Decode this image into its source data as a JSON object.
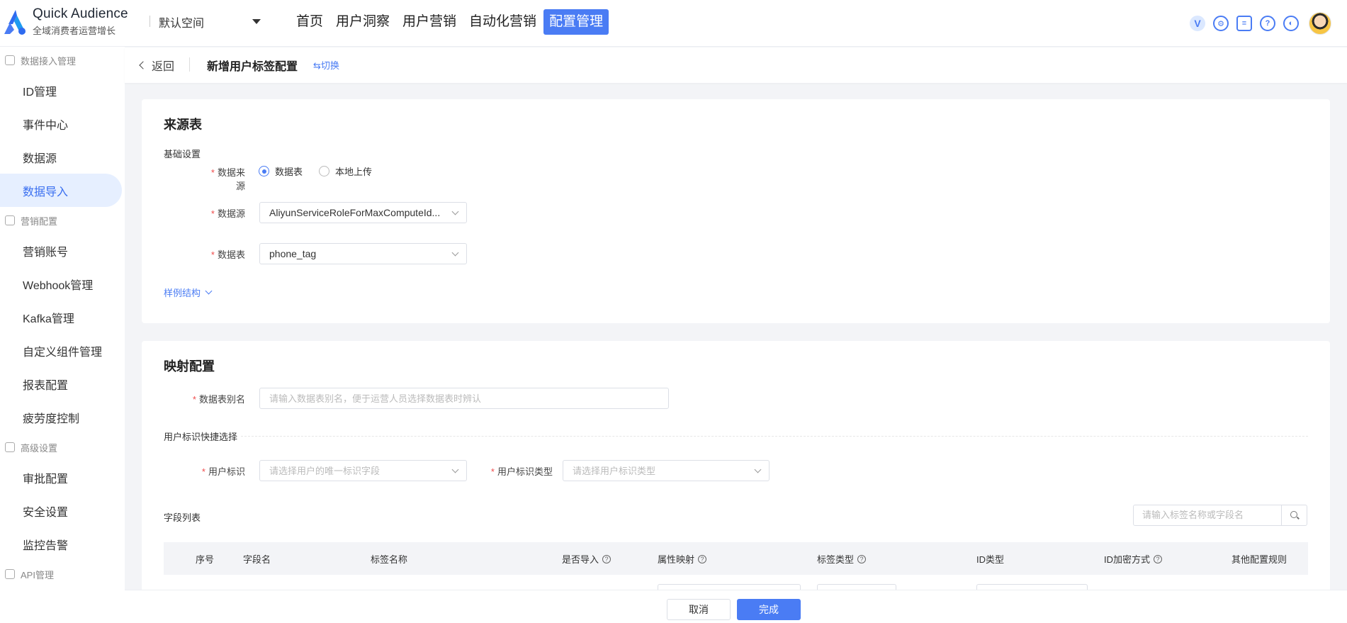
{
  "app": {
    "title": "Quick Audience",
    "subtitle": "全域消费者运营增长"
  },
  "workspace": {
    "current": "默认空间"
  },
  "nav": [
    {
      "label": "首页",
      "active": false
    },
    {
      "label": "用户洞察",
      "active": false
    },
    {
      "label": "用户营销",
      "active": false
    },
    {
      "label": "自动化营销",
      "active": false
    },
    {
      "label": "配置管理",
      "active": true
    }
  ],
  "top_icons": [
    "vip-icon",
    "settings-bug-icon",
    "message-icon",
    "help-icon",
    "globe-icon"
  ],
  "sidebar": {
    "groups": [
      {
        "label": "数据接入管理",
        "items": [
          "ID管理",
          "事件中心",
          "数据源",
          "数据导入"
        ]
      },
      {
        "label": "营销配置",
        "items": [
          "营销账号",
          "Webhook管理",
          "Kafka管理",
          "自定义组件管理",
          "报表配置",
          "疲劳度控制"
        ]
      },
      {
        "label": "高级设置",
        "items": [
          "审批配置",
          "安全设置",
          "监控告警"
        ]
      },
      {
        "label": "API管理",
        "items": []
      }
    ],
    "active_item": "数据导入"
  },
  "subheader": {
    "back": "返回",
    "title": "新增用户标签配置",
    "switch": "⇆切换"
  },
  "source": {
    "title": "来源表",
    "section": "基础设置",
    "source_label": "数据来源",
    "source_options": [
      "数据表",
      "本地上传"
    ],
    "source_selected": "数据表",
    "datasource_label": "数据源",
    "datasource_value": "AliyunServiceRoleForMaxComputeId...",
    "table_label": "数据表",
    "table_value": "phone_tag",
    "sample_link": "样例结构"
  },
  "mapping": {
    "title": "映射配置",
    "alias_label": "数据表别名",
    "alias_placeholder": "请输入数据表别名，便于运营人员选择数据表时辨认",
    "quick_section": "用户标识快捷选择",
    "user_id_label": "用户标识",
    "user_id_placeholder": "请选择用户的唯一标识字段",
    "user_id_type_label": "用户标识类型",
    "user_id_type_placeholder": "请选择用户标识类型",
    "field_list": "字段列表",
    "search_placeholder": "请输入标签名称或字段名",
    "columns": [
      "序号",
      "字段名",
      "标签名称",
      "是否导入",
      "属性映射",
      "标签类型",
      "ID类型",
      "ID加密方式",
      "其他配置规则"
    ]
  },
  "footer": {
    "cancel": "取消",
    "ok": "完成"
  },
  "colors": {
    "primary": "#4a7cf4",
    "required": "#f04c4c"
  }
}
